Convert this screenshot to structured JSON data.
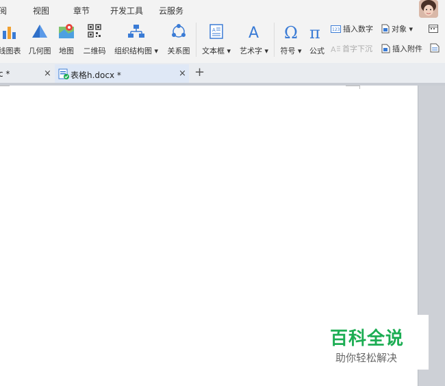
{
  "menubar": {
    "items": [
      "阅",
      "视图",
      "章节",
      "开发工具",
      "云服务"
    ]
  },
  "ribbon": {
    "buttons": {
      "chart": "线图表",
      "geometry": "几何图",
      "map": "地图",
      "qrcode": "二维码",
      "orgchart": "组织结构图 ▾",
      "relation": "关系图",
      "textbox": "文本框 ▾",
      "wordart": "艺术字 ▾",
      "symbol": "符号 ▾",
      "formula": "公式"
    },
    "small": {
      "insert_number": "插入数字",
      "object": "对象 ▾",
      "drop_cap": "首字下沉",
      "insert_attachment": "插入附件"
    }
  },
  "tabs": [
    {
      "label": "c *",
      "close": "×"
    },
    {
      "label": "表格h.docx *",
      "close": "×"
    }
  ],
  "add_tab": "+",
  "watermark": {
    "title": "百科全说",
    "subtitle": "助你轻松解决"
  },
  "colors": {
    "accent": "#3f7fd2",
    "watermark_green": "#1cad53"
  }
}
